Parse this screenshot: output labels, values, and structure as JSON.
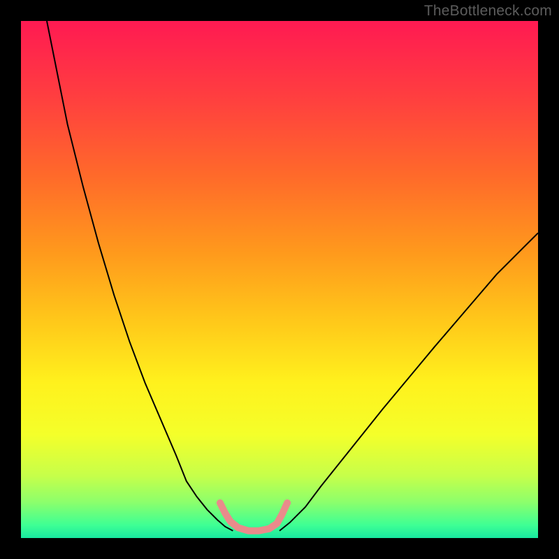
{
  "watermark": "TheBottleneck.com",
  "chart_data": {
    "type": "line",
    "title": "",
    "xlabel": "",
    "ylabel": "",
    "xlim": [
      0,
      100
    ],
    "ylim": [
      0,
      100
    ],
    "grid": false,
    "legend": false,
    "background_gradient_stops": [
      {
        "offset": 0.0,
        "color": "#ff1a52"
      },
      {
        "offset": 0.15,
        "color": "#ff3f3f"
      },
      {
        "offset": 0.3,
        "color": "#ff6a2a"
      },
      {
        "offset": 0.45,
        "color": "#ff9a1c"
      },
      {
        "offset": 0.58,
        "color": "#ffc81a"
      },
      {
        "offset": 0.7,
        "color": "#fff11d"
      },
      {
        "offset": 0.8,
        "color": "#f4ff2a"
      },
      {
        "offset": 0.88,
        "color": "#c6ff4a"
      },
      {
        "offset": 0.93,
        "color": "#8dff6b"
      },
      {
        "offset": 0.975,
        "color": "#3eff94"
      },
      {
        "offset": 1.0,
        "color": "#18e8a0"
      }
    ],
    "series": [
      {
        "name": "curve-left",
        "stroke": "#000000",
        "stroke_width": 2,
        "x": [
          5,
          7,
          9,
          12,
          15,
          18,
          21,
          24,
          27,
          30,
          32,
          34,
          36,
          38,
          39.5,
          41
        ],
        "y": [
          100,
          90,
          80,
          68,
          57,
          47,
          38,
          30,
          23,
          16,
          11,
          8,
          5.5,
          3.5,
          2.2,
          1.4
        ]
      },
      {
        "name": "curve-right",
        "stroke": "#000000",
        "stroke_width": 2,
        "x": [
          50,
          52,
          55,
          58,
          62,
          66,
          70,
          75,
          80,
          86,
          92,
          97,
          100
        ],
        "y": [
          1.4,
          3,
          6,
          10,
          15,
          20,
          25,
          31,
          37,
          44,
          51,
          56,
          59
        ]
      },
      {
        "name": "valley-overlay",
        "stroke": "#e98b8b",
        "stroke_width": 10,
        "linecap": "round",
        "x": [
          38.5,
          39.5,
          40.5,
          42,
          44,
          46,
          48,
          49.5,
          50.5,
          51.5
        ],
        "y": [
          6.8,
          4.8,
          3.2,
          2.0,
          1.4,
          1.4,
          1.8,
          2.8,
          4.6,
          6.8
        ]
      }
    ]
  }
}
